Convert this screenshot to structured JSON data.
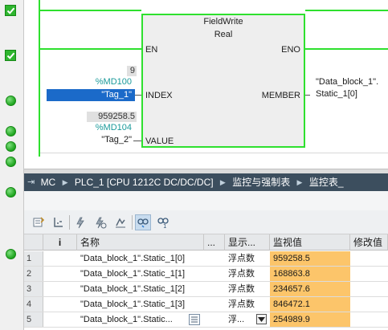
{
  "ladder": {
    "block_name": "FieldWrite",
    "block_type": "Real",
    "pin_en": "EN",
    "pin_eno": "ENO",
    "pin_index": "INDEX",
    "pin_member": "MEMBER",
    "pin_value": "VALUE",
    "index_value": "9",
    "index_address": "%MD100",
    "index_tag": "\"Tag_1\"",
    "value_value": "959258.5",
    "value_address": "%MD104",
    "value_tag": "\"Tag_2\"",
    "member_tag_line1": "\"Data_block_1\".",
    "member_tag_line2": "Static_1[0]"
  },
  "breadcrumb": {
    "items": [
      "MC",
      "PLC_1 [CPU 1212C DC/DC/DC]",
      "监控与强制表",
      "监控表_"
    ]
  },
  "table": {
    "headers": {
      "info": "i",
      "name": "名称",
      "dots": "...",
      "display": "显示...",
      "monitor": "监视值",
      "modify": "修改值"
    },
    "rows": [
      {
        "num": "1",
        "name": "\"Data_block_1\".Static_1[0]",
        "display": "浮点数",
        "monitor": "959258.5"
      },
      {
        "num": "2",
        "name": "\"Data_block_1\".Static_1[1]",
        "display": "浮点数",
        "monitor": "168863.8"
      },
      {
        "num": "3",
        "name": "\"Data_block_1\".Static_1[2]",
        "display": "浮点数",
        "monitor": "234657.6"
      },
      {
        "num": "4",
        "name": "\"Data_block_1\".Static_1[3]",
        "display": "浮点数",
        "monitor": "846472.1"
      },
      {
        "num": "5",
        "name": "\"Data_block_1\".Static...",
        "display": "浮...",
        "monitor": "254989.9"
      }
    ]
  },
  "colors": {
    "rail_green": "#2ee02e",
    "selected_tag_bg": "#1b6ac9",
    "address_teal": "#1a9a9a",
    "monitor_orange": "#fcc56a",
    "breadcrumb_bg": "#3c4e5e"
  },
  "icons": [
    "checkmark-icon",
    "status-ok-icon",
    "chevron-right-icon",
    "table-icon",
    "dropdown-arrow-icon"
  ]
}
